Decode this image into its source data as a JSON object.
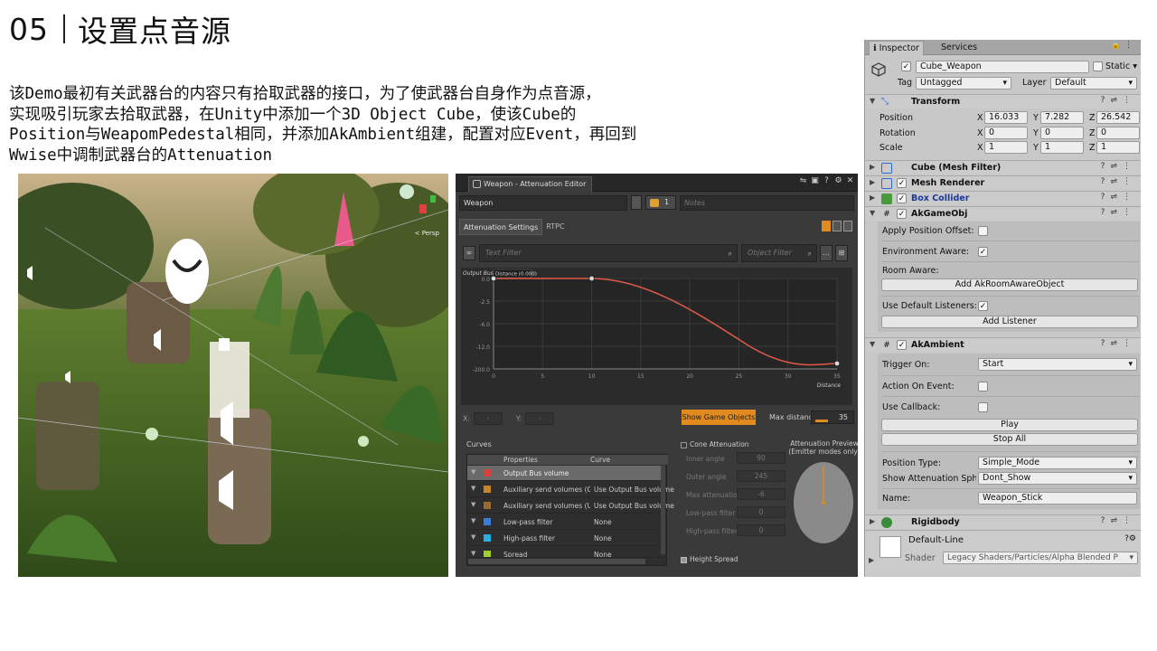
{
  "slide": {
    "number": "05",
    "title": "设置点音源",
    "description_lines": [
      "该Demo最初有关武器台的内容只有拾取武器的接口，为了使武器台自身作为点音源，",
      "实现吸引玩家去拾取武器，在Unity中添加一个3D Object Cube，使该Cube的",
      "Position与WeapomPedestal相同，并添加AkAmbient组建，配置对应Event，再回到",
      "Wwise中调制武器台的Attenuation"
    ]
  },
  "scene": {
    "persp_label": "< Persp"
  },
  "attenuation_editor": {
    "window_title": "Weapon - Attenuation Editor",
    "name": "Weapon",
    "ref_count": "1",
    "notes_placeholder": "Notes",
    "tabs": [
      "Attenuation Settings",
      "RTPC"
    ],
    "text_filter_placeholder": "Text Filter",
    "object_filter_placeholder": "Object Filter",
    "graph_y_title": "Output Bus volu",
    "graph_tooltip": "Distance (0.000)",
    "x_axis_label": "Distance",
    "x_label": "X:",
    "y_label": "Y:",
    "x_value": "-",
    "y_value": "-",
    "show_game_objects": "Show Game Objects",
    "max_distance_label": "Max distance",
    "max_distance": "35",
    "curves_label": "Curves",
    "table_headers": [
      "Properties",
      "Curve"
    ],
    "table_rows": [
      {
        "property": "Output Bus volume",
        "curve": "",
        "color": "#d84040"
      },
      {
        "property": "Auxiliary send volumes (Ga...",
        "curve": "Use Output Bus volume",
        "color": "#c8862a"
      },
      {
        "property": "Auxiliary send volumes (Us...",
        "curve": "Use Output Bus volume",
        "color": "#9a6a30"
      },
      {
        "property": "Low-pass filter",
        "curve": "None",
        "color": "#3a7ad8"
      },
      {
        "property": "High-pass filter",
        "curve": "None",
        "color": "#2ab0e0"
      },
      {
        "property": "Spread",
        "curve": "None",
        "color": "#a0d030"
      }
    ],
    "cone_attenuation": "Cone Attenuation",
    "cone_params": [
      {
        "label": "Inner angle",
        "value": "90"
      },
      {
        "label": "Outer angle",
        "value": "245"
      },
      {
        "label": "Max attenuation",
        "value": "-6"
      },
      {
        "label": "Low-pass filter",
        "value": "0"
      },
      {
        "label": "High-pass filter",
        "value": "0"
      }
    ],
    "preview_title": "Attenuation Preview",
    "preview_subtitle": "(Emitter modes only)",
    "height_spread": "Height Spread"
  },
  "chart_data": {
    "type": "line",
    "title": "",
    "xlabel": "Distance",
    "ylabel": "Output Bus volu",
    "xlim": [
      0,
      35
    ],
    "ylim": [
      -200,
      0
    ],
    "x_ticks": [
      "0",
      "5",
      "10",
      "15",
      "20",
      "25",
      "30",
      "35"
    ],
    "y_ticks": [
      "0.0",
      "-2.5",
      "-6.0",
      "-12.0",
      "-200.0"
    ],
    "series": [
      {
        "x": [
          0,
          10,
          15,
          20,
          25,
          30,
          35
        ],
        "y_label": [
          "0.0",
          "0.0",
          "-1.0",
          "-3.5",
          "-8.0",
          "-14.0",
          "-200.0"
        ],
        "control_points": [
          [
            0,
            "0.0"
          ],
          [
            10,
            "0.0"
          ],
          [
            35,
            "-200.0"
          ]
        ]
      }
    ]
  },
  "inspector": {
    "tabs": [
      "Inspector",
      "Services"
    ],
    "object_name": "Cube_Weapon",
    "static_label": "Static",
    "tag_label": "Tag",
    "tag_value": "Untagged",
    "layer_label": "Layer",
    "layer_value": "Default",
    "transform": {
      "name": "Transform",
      "position_label": "Position",
      "rotation_label": "Rotation",
      "scale_label": "Scale",
      "position": {
        "x": "16.033",
        "y": "7.282",
        "z": "26.542"
      },
      "rotation": {
        "x": "0",
        "y": "0",
        "z": "0"
      },
      "scale": {
        "x": "1",
        "y": "1",
        "z": "1"
      }
    },
    "components": {
      "mesh_filter": "Cube (Mesh Filter)",
      "mesh_renderer": "Mesh Renderer",
      "box_collider": "Box Collider",
      "ak_game_obj": "AkGameObj",
      "ak_ambient": "AkAmbient",
      "rigidbody": "Rigidbody"
    },
    "akgameobj": {
      "apply_position_offset": "Apply Position Offset:",
      "environment_aware": "Environment Aware:",
      "room_aware": "Room Aware:",
      "add_room_aware_button": "Add AkRoomAwareObject",
      "use_default_listeners": "Use Default Listeners:",
      "add_listener_button": "Add Listener"
    },
    "akambient": {
      "trigger_on_label": "Trigger On:",
      "trigger_on_value": "Start",
      "action_on_event": "Action On Event:",
      "use_callback": "Use Callback:",
      "play_button": "Play",
      "stop_all_button": "Stop All",
      "position_type_label": "Position Type:",
      "position_type_value": "Simple_Mode",
      "show_attenuation_label": "Show Attenuation Sph",
      "show_attenuation_value": "Dont_Show",
      "name_label": "Name:",
      "name_value": "Weapon_Stick"
    },
    "material": {
      "name": "Default-Line",
      "shader_label": "Shader",
      "shader_value": "Legacy Shaders/Particles/Alpha Blended P"
    }
  }
}
